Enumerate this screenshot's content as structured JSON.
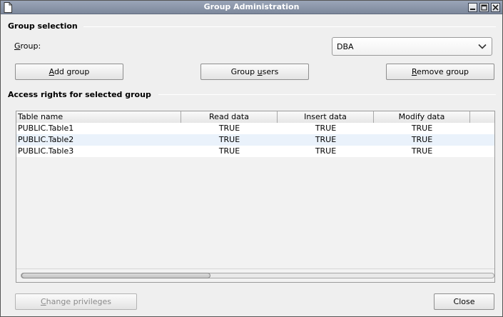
{
  "window": {
    "title": "Group Administration"
  },
  "group_selection": {
    "header": "Group selection",
    "group_label_mnemonic": "G",
    "group_label_rest": "roup:",
    "selected_group": "DBA",
    "add_group_mnemonic": "A",
    "add_group_rest": "dd group",
    "group_users_pre": "Group ",
    "group_users_mnemonic": "u",
    "group_users_post": "sers",
    "remove_group_mnemonic": "R",
    "remove_group_rest": "emove group"
  },
  "access_rights": {
    "header": "Access rights for selected group",
    "columns": [
      "Table name",
      "Read data",
      "Insert data",
      "Modify data"
    ],
    "rows": [
      {
        "table": "PUBLIC.Table1",
        "read": "TRUE",
        "insert": "TRUE",
        "modify": "TRUE"
      },
      {
        "table": "PUBLIC.Table2",
        "read": "TRUE",
        "insert": "TRUE",
        "modify": "TRUE"
      },
      {
        "table": "PUBLIC.Table3",
        "read": "TRUE",
        "insert": "TRUE",
        "modify": "TRUE"
      }
    ],
    "scroll_position": 0.0,
    "row_colors": [
      "#ffffff",
      "#eaf2fb",
      "#ffffff"
    ]
  },
  "footer": {
    "change_privileges_mnemonic": "C",
    "change_privileges_rest": "hange privileges",
    "close_label": "Close"
  },
  "icons": {
    "title_icon": "document-icon",
    "minimize": "minimize-icon",
    "maximize": "maximize-icon",
    "close": "close-icon",
    "dropdown": "chevron-down-icon"
  }
}
